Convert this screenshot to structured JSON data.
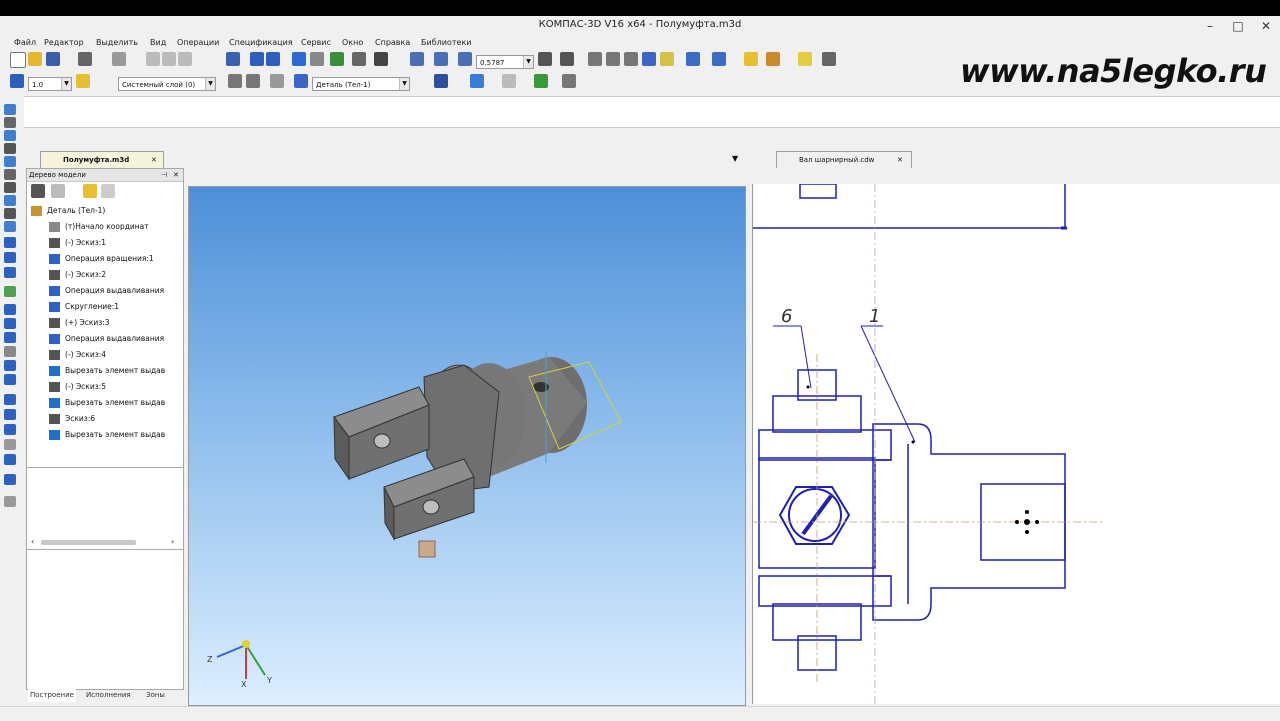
{
  "window": {
    "title": "КОМПАС-3D V16  x64 - Полумуфта.m3d",
    "controls": {
      "minimize": "–",
      "maximize": "□",
      "close": "✕"
    }
  },
  "menu": [
    "Файл",
    "Редактор",
    "Выделить",
    "Вид",
    "Операции",
    "Спецификация",
    "Сервис",
    "Окно",
    "Справка",
    "Библиотеки"
  ],
  "toolbar": {
    "zoom_value": "0.5787",
    "line_width": "1.0",
    "layer": "Системный слой (0)",
    "part": "Деталь (Тел-1)"
  },
  "watermark": "www.na5legko.ru",
  "tabs": {
    "model_doc": "Полумуфта.m3d",
    "drawing_doc": "Вал шарнирный.cdw"
  },
  "tree": {
    "header": "Дерево модели",
    "items": [
      {
        "label": "Деталь (Тел-1)",
        "icon": "part-icon"
      },
      {
        "label": "(т)Начало координат",
        "icon": "origin-icon"
      },
      {
        "label": "(-) Эскиз:1",
        "icon": "sketch-icon"
      },
      {
        "label": "Операция вращения:1",
        "icon": "revolve-icon"
      },
      {
        "label": "(-) Эскиз:2",
        "icon": "sketch-icon"
      },
      {
        "label": "Операция выдавливания",
        "icon": "extrude-icon"
      },
      {
        "label": "Скругление:1",
        "icon": "fillet-icon"
      },
      {
        "label": "(+) Эскиз:3",
        "icon": "sketch-icon"
      },
      {
        "label": "Операция выдавливания",
        "icon": "extrude-icon"
      },
      {
        "label": "(-) Эскиз:4",
        "icon": "sketch-icon"
      },
      {
        "label": "Вырезать элемент выдав",
        "icon": "cut-icon"
      },
      {
        "label": "(-) Эскиз:5",
        "icon": "sketch-icon"
      },
      {
        "label": "Вырезать элемент выдав",
        "icon": "cut-icon"
      },
      {
        "label": "Эскиз:6",
        "icon": "sketch-icon"
      },
      {
        "label": "Вырезать элемент выдав",
        "icon": "cut-icon"
      }
    ]
  },
  "bottom_tabs": [
    "Построение",
    "Исполнения",
    "Зоны"
  ],
  "drawing": {
    "leader_labels": [
      "6",
      "1"
    ]
  },
  "axis_labels": {
    "x": "X",
    "y": "Y",
    "z": "Z"
  },
  "colors": {
    "viewport_top": "#4d8fd8",
    "viewport_bottom": "#ddeeff",
    "drawing_line": "#1f1fb0",
    "tab_active": "#f6f3dc"
  }
}
